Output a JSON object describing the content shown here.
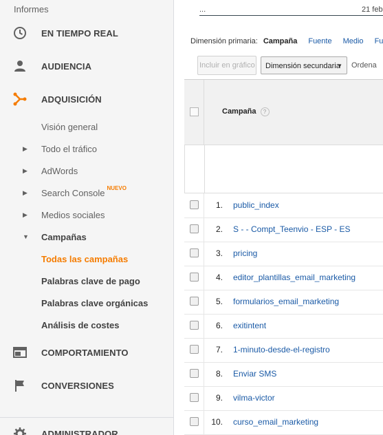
{
  "sidebar": {
    "header": "Informes",
    "main_items": [
      {
        "label": "EN TIEMPO REAL",
        "icon": "clock-icon"
      },
      {
        "label": "AUDIENCIA",
        "icon": "person-icon"
      },
      {
        "label": "ADQUISICIÓN",
        "icon": "acquisition-icon"
      },
      {
        "label": "COMPORTAMIENTO",
        "icon": "window-icon"
      },
      {
        "label": "CONVERSIONES",
        "icon": "flag-icon"
      },
      {
        "label": "ADMINISTRADOR",
        "icon": "gear-icon"
      }
    ],
    "sub_items": [
      {
        "label": "Visión general"
      },
      {
        "label": "Todo el tráfico"
      },
      {
        "label": "AdWords"
      },
      {
        "label": "Search Console",
        "badge": "NUEVO"
      },
      {
        "label": "Medios sociales"
      },
      {
        "label": "Campañas"
      },
      {
        "label": "Todas las campañas"
      },
      {
        "label": "Palabras clave de pago"
      },
      {
        "label": "Palabras clave orgánicas"
      },
      {
        "label": "Análisis de costes"
      }
    ],
    "accent_color": "#f57c00"
  },
  "chart": {
    "dots": "...",
    "date": "21 feb"
  },
  "dimension": {
    "label": "Dimensión primaria:",
    "selected": "Campaña",
    "options": [
      "Fuente",
      "Medio",
      "Fue"
    ]
  },
  "toolbar": {
    "include_chart": "Incluir en gráfico",
    "secondary_dimension": "Dimensión secundaria",
    "sort": "Ordena"
  },
  "table": {
    "column_header": "Campaña",
    "help": "?",
    "rows": [
      {
        "num": "1.",
        "name": "public_index"
      },
      {
        "num": "2.",
        "name": "S - - Compt_Teenvio - ESP - ES"
      },
      {
        "num": "3.",
        "name": "pricing"
      },
      {
        "num": "4.",
        "name": "editor_plantillas_email_marketing"
      },
      {
        "num": "5.",
        "name": "formularios_email_marketing"
      },
      {
        "num": "6.",
        "name": "exitintent"
      },
      {
        "num": "7.",
        "name": "1-minuto-desde-el-registro"
      },
      {
        "num": "8.",
        "name": "Enviar SMS"
      },
      {
        "num": "9.",
        "name": "vilma-victor"
      },
      {
        "num": "10.",
        "name": "curso_email_marketing"
      }
    ]
  }
}
